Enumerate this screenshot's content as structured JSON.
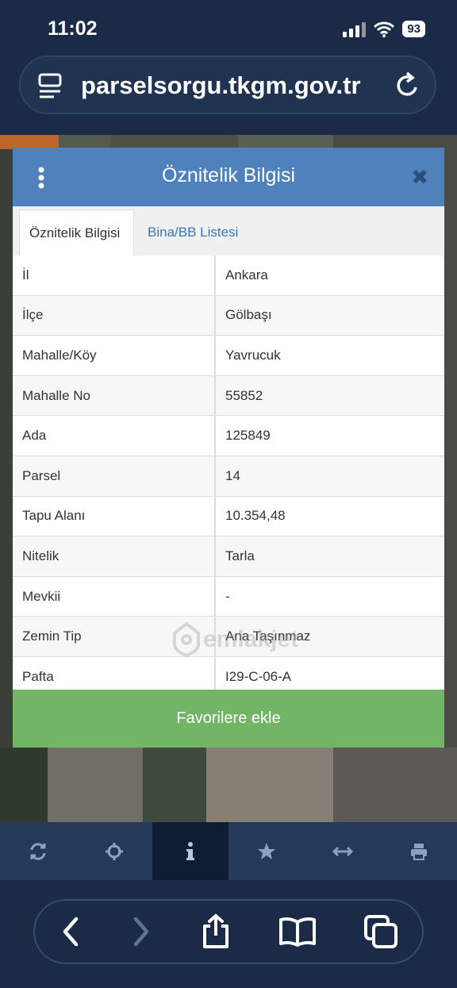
{
  "status": {
    "time": "11:02",
    "battery": "93"
  },
  "browser": {
    "url": "parselsorgu.tkgm.gov.tr"
  },
  "dialog": {
    "title": "Öznitelik Bilgisi",
    "tabs": [
      {
        "label": "Öznitelik Bilgisi"
      },
      {
        "label": "Bina/BB Listesi"
      }
    ],
    "rows": [
      {
        "key": "İl",
        "value": "Ankara"
      },
      {
        "key": "İlçe",
        "value": "Gölbaşı"
      },
      {
        "key": "Mahalle/Köy",
        "value": "Yavrucuk"
      },
      {
        "key": "Mahalle No",
        "value": "55852"
      },
      {
        "key": "Ada",
        "value": "125849"
      },
      {
        "key": "Parsel",
        "value": "14"
      },
      {
        "key": "Tapu Alanı",
        "value": "10.354,48"
      },
      {
        "key": "Nitelik",
        "value": "Tarla"
      },
      {
        "key": "Mevkii",
        "value": "-"
      },
      {
        "key": "Zemin Tip",
        "value": "Ana Taşınmaz"
      },
      {
        "key": "Pafta",
        "value": "I29-C-06-A"
      }
    ],
    "favorite_button": "Favorilere ekle",
    "watermark": "emlakjet"
  },
  "colors": {
    "header": "#4f81bd",
    "button": "#72b566",
    "toolbar": "#243a5a"
  }
}
